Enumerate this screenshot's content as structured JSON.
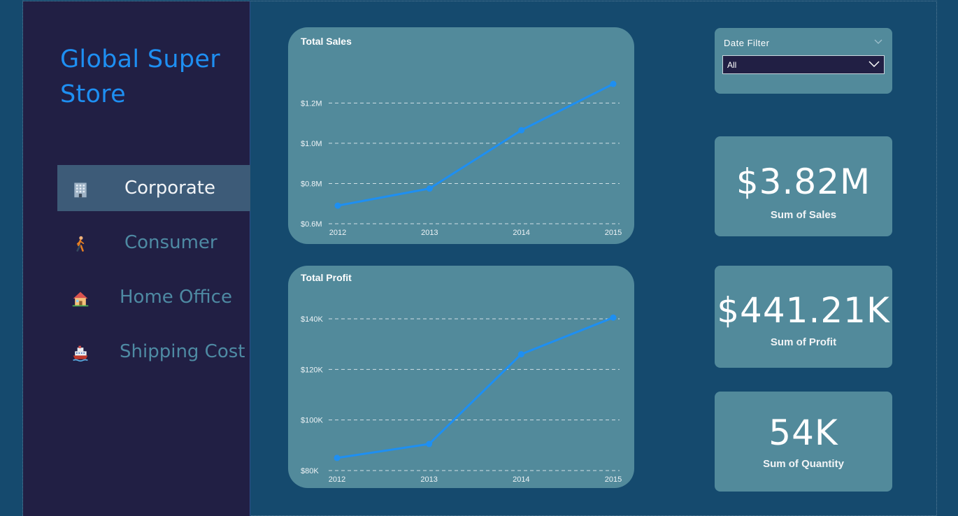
{
  "app": {
    "title": "Global Super Store"
  },
  "sidebar": {
    "items": [
      {
        "label": "Corporate",
        "icon": "building-icon",
        "active": true
      },
      {
        "label": "Consumer",
        "icon": "person-walking-icon",
        "active": false
      },
      {
        "label": "Home Office",
        "icon": "house-icon",
        "active": false
      },
      {
        "label": "Shipping Cost",
        "icon": "ship-icon",
        "active": false
      }
    ]
  },
  "filter": {
    "label": "Date Filter",
    "selected": "All"
  },
  "kpis": [
    {
      "value": "$3.82M",
      "label": "Sum of Sales"
    },
    {
      "value": "$441.21K",
      "label": "Sum of Profit"
    },
    {
      "value": "54K",
      "label": "Sum of Quantity"
    }
  ],
  "colors": {
    "background": "#154a6e",
    "sidebar": "#211f44",
    "card": "#528a9b",
    "accent": "#1e8ff2",
    "line": "#1e8ff2"
  },
  "chart_data": [
    {
      "type": "line",
      "title": "Total Sales",
      "x": [
        "2012",
        "2013",
        "2014",
        "2015"
      ],
      "series": [
        {
          "values": [
            690000,
            775000,
            1065000,
            1295000
          ]
        }
      ],
      "yticks": [
        600000,
        800000,
        1000000,
        1200000
      ],
      "ytick_labels": [
        "$0.6M",
        "$0.8M",
        "$1.0M",
        "$1.2M"
      ],
      "ylim": [
        600000,
        1300000
      ],
      "grid": true
    },
    {
      "type": "line",
      "title": "Total Profit",
      "x": [
        "2012",
        "2013",
        "2014",
        "2015"
      ],
      "series": [
        {
          "values": [
            85000,
            90500,
            126000,
            140500
          ]
        }
      ],
      "yticks": [
        80000,
        100000,
        120000,
        140000
      ],
      "ytick_labels": [
        "$80K",
        "$100K",
        "$120K",
        "$140K"
      ],
      "ylim": [
        80000,
        140000
      ],
      "grid": true
    }
  ]
}
